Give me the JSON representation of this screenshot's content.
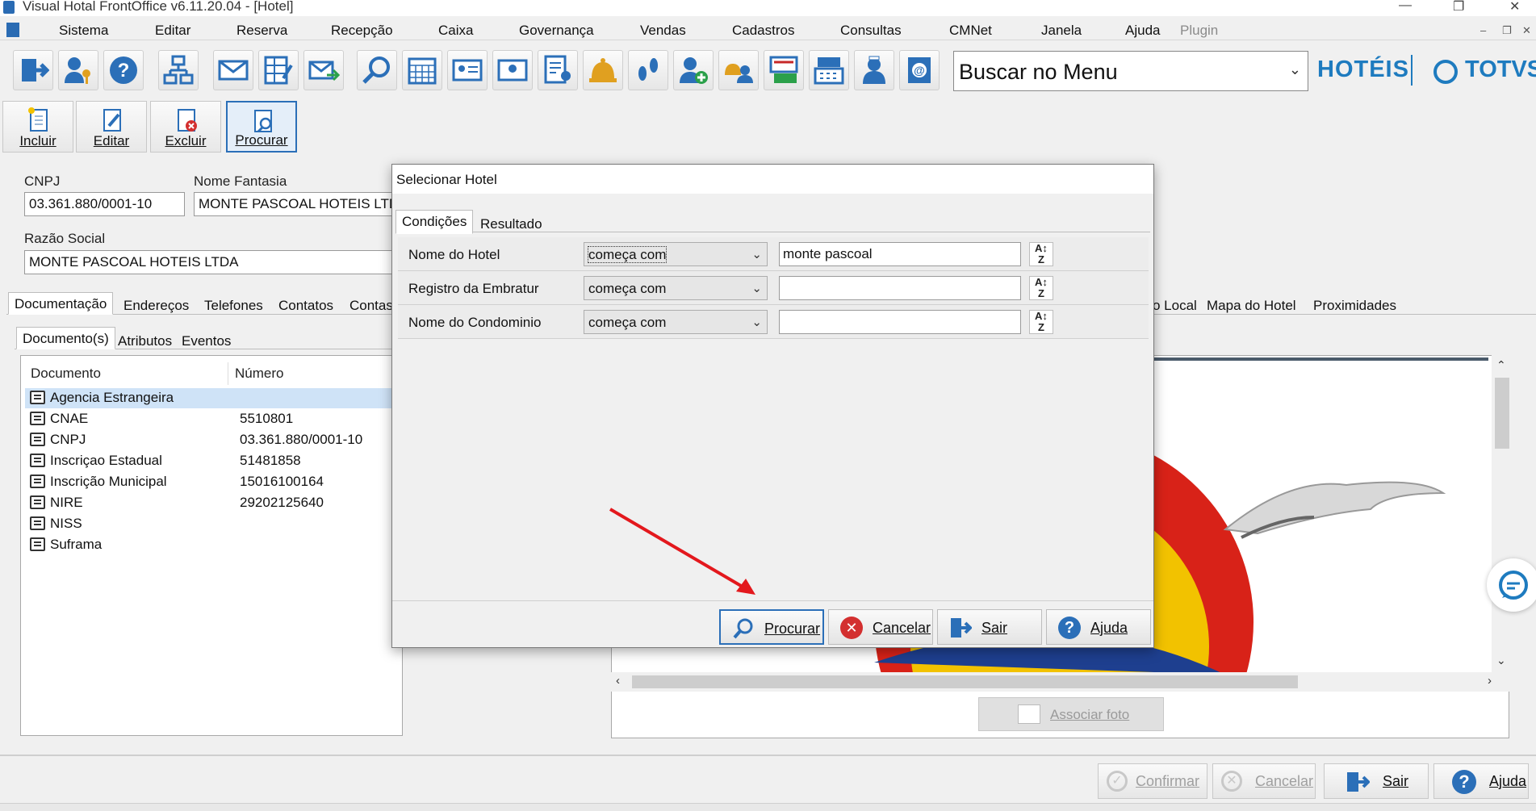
{
  "window": {
    "title": "Visual Hotal FrontOffice v6.11.20.04 - [Hotel]",
    "controls": [
      "—",
      "❐",
      "✕"
    ]
  },
  "menu": {
    "items": [
      "Sistema",
      "Editar",
      "Reserva",
      "Recepção",
      "Caixa",
      "Governança",
      "Vendas",
      "Cadastros",
      "Consultas",
      "CMNet",
      "Janela",
      "Ajuda",
      "Plugin"
    ],
    "right_controls": [
      "–",
      "❐",
      "✕"
    ]
  },
  "toolbar": {
    "menu_search_value": "Buscar no Menu",
    "brand_hoteis": "HOTÉIS",
    "brand_totvs": "TOTVS"
  },
  "actions": {
    "incluir": "Incluir",
    "editar": "Editar",
    "excluir": "Excluir",
    "procurar": "Procurar"
  },
  "form": {
    "cnpj_label": "CNPJ",
    "cnpj_value": "03.361.880/0001-10",
    "fantasia_label": "Nome Fantasia",
    "fantasia_value": "MONTE PASCOAL HOTEIS LTDA",
    "razao_label": "Razão Social",
    "razao_value": "MONTE PASCOAL HOTEIS LTDA"
  },
  "main_tabs_left": [
    "Documentação",
    "Endereços",
    "Telefones",
    "Contatos",
    "Contas"
  ],
  "main_tabs_right": [
    "o Local",
    "Mapa do Hotel",
    "Proximidades"
  ],
  "sub_tabs": [
    "Documento(s)",
    "Atributos",
    "Eventos"
  ],
  "documents": {
    "headers": [
      "Documento",
      "Número"
    ],
    "rows": [
      {
        "name": "Agencia Estrangeira",
        "number": ""
      },
      {
        "name": "CNAE",
        "number": "5510801"
      },
      {
        "name": "CNPJ",
        "number": "03.361.880/0001-10"
      },
      {
        "name": "Inscriçao Estadual",
        "number": "51481858"
      },
      {
        "name": "Inscrição Municipal",
        "number": "15016100164"
      },
      {
        "name": "NIRE",
        "number": "29202125640"
      },
      {
        "name": "NISS",
        "number": ""
      },
      {
        "name": "Suframa",
        "number": ""
      }
    ]
  },
  "photo": {
    "associate_label": "Associar foto"
  },
  "bottom_buttons": {
    "confirmar": "Confirmar",
    "cancelar": "Cancelar",
    "sair": "Sair",
    "ajuda": "Ajuda"
  },
  "dialog": {
    "title": "Selecionar Hotel",
    "tabs": [
      "Condições",
      "Resultado"
    ],
    "conditions": [
      {
        "label": "Nome do Hotel",
        "operator": "começa com",
        "value": "monte pascoal"
      },
      {
        "label": "Registro da Embratur",
        "operator": "começa com",
        "value": ""
      },
      {
        "label": "Nome do Condominio",
        "operator": "começa com",
        "value": ""
      }
    ],
    "sort_icon": "A-Z sort",
    "buttons": {
      "procurar": "Procurar",
      "cancelar": "Cancelar",
      "sair": "Sair",
      "ajuda": "Ajuda"
    }
  },
  "colors": {
    "accent": "#2b6fb8",
    "brand": "#1e7bbf",
    "annotation_arrow": "#e3181d"
  }
}
